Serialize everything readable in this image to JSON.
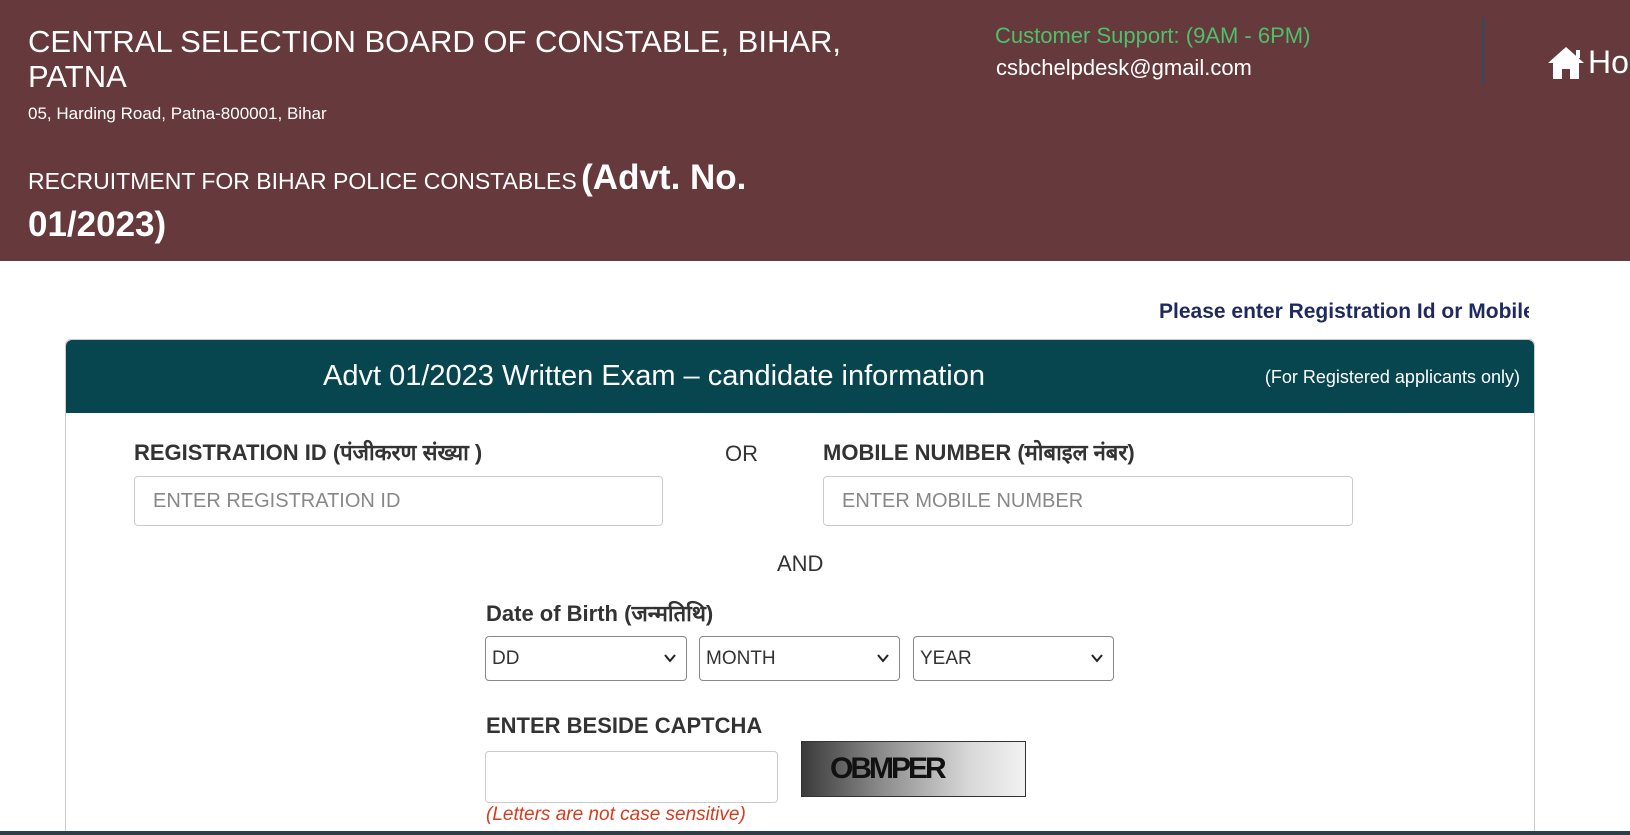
{
  "header": {
    "org_title": "CENTRAL SELECTION BOARD OF CONSTABLE, BIHAR, PATNA",
    "address": "05, Harding Road, Patna-800001, Bihar",
    "recruitment_text": "RECRUITMENT FOR BIHAR POLICE CONSTABLES",
    "advt_text": "(Advt. No. 01/2023)",
    "support_label": "Customer Support: (9AM - 6PM)",
    "support_email": "csbchelpdesk@gmail.com",
    "home_label": "Home",
    "colors": {
      "background": "#663a3c",
      "support_text": "#4cc06a"
    }
  },
  "notice": "Please enter Registration Id or Mobile Number",
  "card": {
    "title": "Advt 01/2023 Written Exam – candidate information",
    "subtitle": "(For Registered applicants only)",
    "header_color": "#07464f"
  },
  "form": {
    "registration_label": "REGISTRATION ID (पंजीकरण संख्या )",
    "registration_placeholder": "ENTER REGISTRATION ID",
    "or_text": "OR",
    "mobile_label": "MOBILE NUMBER (मोबाइल नंबर)",
    "mobile_placeholder": "ENTER MOBILE NUMBER",
    "and_text": "AND",
    "dob_label": "Date of Birth (जन्मतिथि)",
    "dob_day": "DD",
    "dob_month": "MONTH",
    "dob_year": "YEAR",
    "captcha_label": "ENTER BESIDE CAPTCHA",
    "captcha_text": "OBMPER",
    "captcha_note": "(Letters are not case sensitive)",
    "note_color": "#d63b1f"
  },
  "icons": [
    "home-icon",
    "chevron-down-icon"
  ]
}
